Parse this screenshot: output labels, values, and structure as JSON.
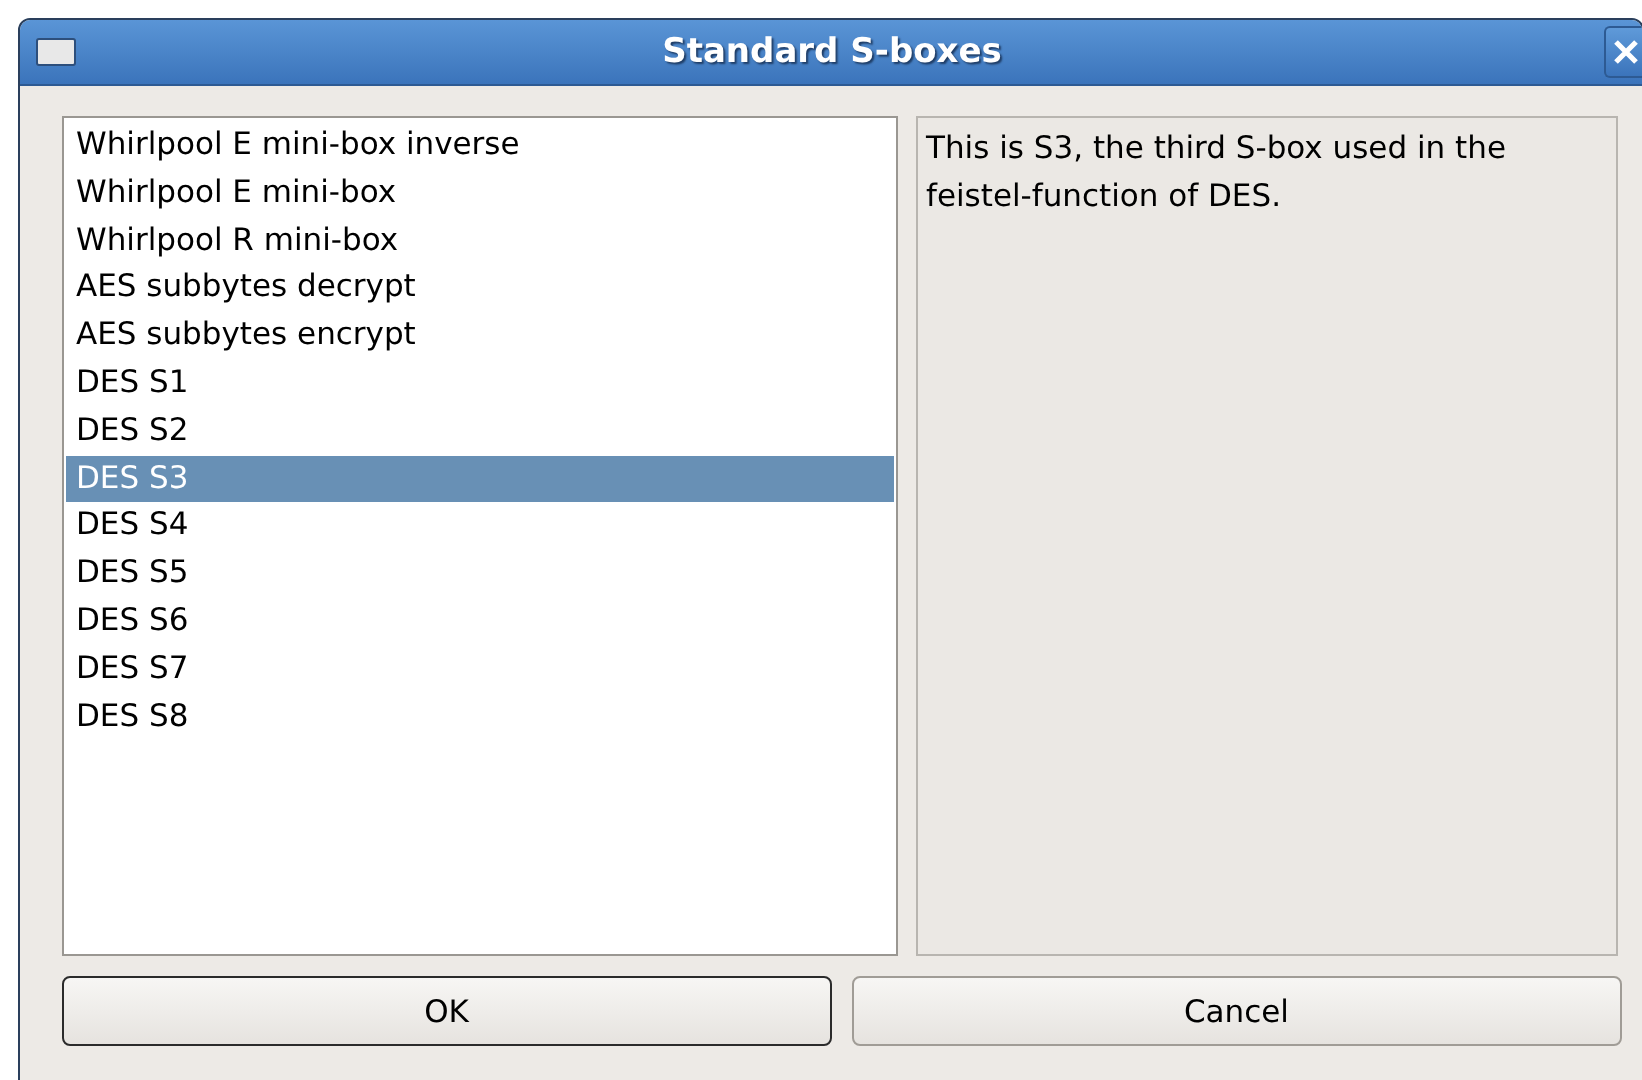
{
  "window": {
    "title": "Standard S-boxes"
  },
  "sboxes": [
    {
      "label": "Whirlpool E mini-box inverse",
      "selected": false
    },
    {
      "label": "Whirlpool E mini-box",
      "selected": false
    },
    {
      "label": "Whirlpool R mini-box",
      "selected": false
    },
    {
      "label": "AES subbytes decrypt",
      "selected": false
    },
    {
      "label": "AES subbytes encrypt",
      "selected": false
    },
    {
      "label": "DES S1",
      "selected": false
    },
    {
      "label": "DES S2",
      "selected": false
    },
    {
      "label": "DES S3",
      "selected": true
    },
    {
      "label": "DES S4",
      "selected": false
    },
    {
      "label": "DES S5",
      "selected": false
    },
    {
      "label": "DES S6",
      "selected": false
    },
    {
      "label": "DES S7",
      "selected": false
    },
    {
      "label": "DES S8",
      "selected": false
    }
  ],
  "description": "This is S3, the third S-box used in the feistel-function of DES.",
  "buttons": [
    {
      "label": "OK",
      "default": true
    },
    {
      "label": "Cancel",
      "default": false
    }
  ]
}
